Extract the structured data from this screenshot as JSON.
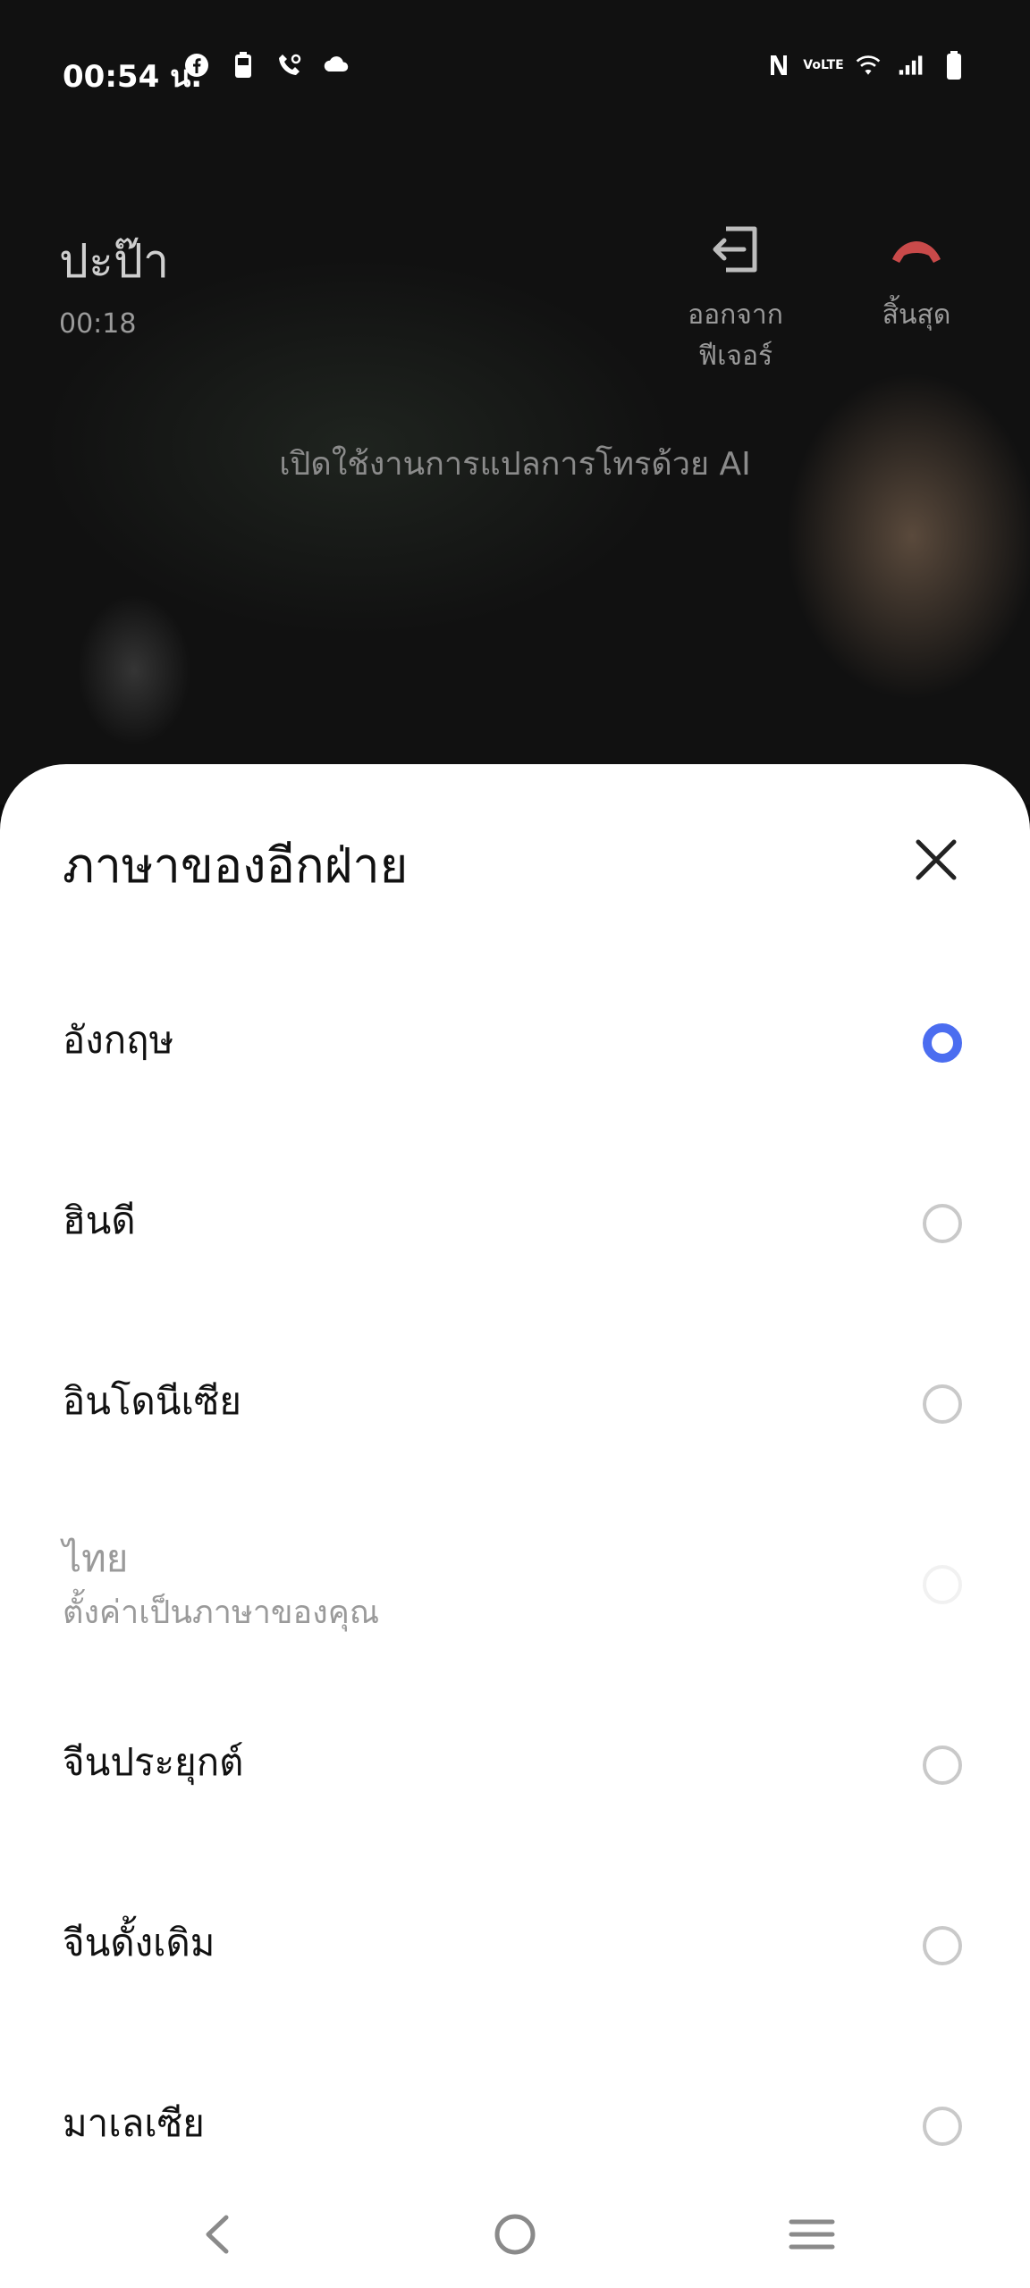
{
  "status_bar": {
    "time": "00:54 น.",
    "left_icons": [
      "facebook-icon",
      "battery-saver-icon",
      "call-icon",
      "cloud-icon"
    ],
    "right_icons": [
      "nfc-icon",
      "volte-icon",
      "wifi-icon",
      "signal-icon",
      "battery-icon"
    ],
    "volte_text": "VoLTE"
  },
  "call": {
    "caller_name": "ปะป๊า",
    "timer": "00:18",
    "exit_label_line1": "ออกจาก",
    "exit_label_line2": "ฟีเจอร์",
    "end_label": "สิ้นสุด",
    "ai_banner": "เปิดใช้งานการแปลการโทรด้วย AI",
    "end_color": "#c94a4a"
  },
  "sheet": {
    "title": "ภาษาของอีกฝ่าย",
    "accent": "#4b6df0",
    "options": [
      {
        "name": "อังกฤษ",
        "selected": true
      },
      {
        "name": "ฮินดี",
        "selected": false
      },
      {
        "name": "อินโดนีเซีย",
        "selected": false
      },
      {
        "name": "ไทย",
        "subtitle": "ตั้งค่าเป็นภาษาของคุณ",
        "disabled": true
      },
      {
        "name": "จีนประยุกต์",
        "selected": false
      },
      {
        "name": "จีนดั้งเดิม",
        "selected": false
      },
      {
        "name": "มาเลเซีย",
        "selected": false
      }
    ]
  },
  "nav_bar": {
    "buttons": [
      "back-icon",
      "home-icon",
      "recents-icon"
    ]
  }
}
